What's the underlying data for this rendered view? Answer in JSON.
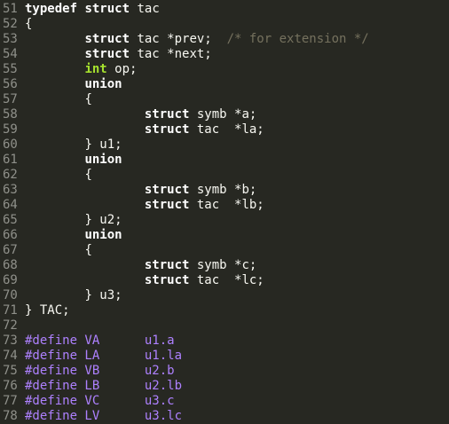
{
  "editor": {
    "lines": [
      {
        "num": "51",
        "segments": [
          {
            "t": "kw",
            "v": "typedef"
          },
          {
            "t": "ws",
            "v": " "
          },
          {
            "t": "kw",
            "v": "struct"
          },
          {
            "t": "plain",
            "v": " tac"
          }
        ]
      },
      {
        "num": "52",
        "segments": [
          {
            "t": "plain",
            "v": "{"
          }
        ]
      },
      {
        "num": "53",
        "segments": [
          {
            "t": "ws",
            "v": "        "
          },
          {
            "t": "kw",
            "v": "struct"
          },
          {
            "t": "plain",
            "v": " tac *prev;  "
          },
          {
            "t": "cmt",
            "v": "/* for extension */"
          }
        ]
      },
      {
        "num": "54",
        "segments": [
          {
            "t": "ws",
            "v": "        "
          },
          {
            "t": "kw",
            "v": "struct"
          },
          {
            "t": "plain",
            "v": " tac *next;"
          }
        ]
      },
      {
        "num": "55",
        "segments": [
          {
            "t": "ws",
            "v": "        "
          },
          {
            "t": "type",
            "v": "int"
          },
          {
            "t": "plain",
            "v": " op;"
          }
        ]
      },
      {
        "num": "56",
        "segments": [
          {
            "t": "ws",
            "v": "        "
          },
          {
            "t": "kw",
            "v": "union"
          }
        ]
      },
      {
        "num": "57",
        "segments": [
          {
            "t": "ws",
            "v": "        "
          },
          {
            "t": "plain",
            "v": "{"
          }
        ]
      },
      {
        "num": "58",
        "segments": [
          {
            "t": "ws",
            "v": "                "
          },
          {
            "t": "kw",
            "v": "struct"
          },
          {
            "t": "plain",
            "v": " symb *a;"
          }
        ]
      },
      {
        "num": "59",
        "segments": [
          {
            "t": "ws",
            "v": "                "
          },
          {
            "t": "kw",
            "v": "struct"
          },
          {
            "t": "plain",
            "v": " tac  *la;"
          }
        ]
      },
      {
        "num": "60",
        "segments": [
          {
            "t": "ws",
            "v": "        "
          },
          {
            "t": "plain",
            "v": "} u1;"
          }
        ]
      },
      {
        "num": "61",
        "segments": [
          {
            "t": "ws",
            "v": "        "
          },
          {
            "t": "kw",
            "v": "union"
          }
        ]
      },
      {
        "num": "62",
        "segments": [
          {
            "t": "ws",
            "v": "        "
          },
          {
            "t": "plain",
            "v": "{"
          }
        ]
      },
      {
        "num": "63",
        "segments": [
          {
            "t": "ws",
            "v": "                "
          },
          {
            "t": "kw",
            "v": "struct"
          },
          {
            "t": "plain",
            "v": " symb *b;"
          }
        ]
      },
      {
        "num": "64",
        "segments": [
          {
            "t": "ws",
            "v": "                "
          },
          {
            "t": "kw",
            "v": "struct"
          },
          {
            "t": "plain",
            "v": " tac  *lb;"
          }
        ]
      },
      {
        "num": "65",
        "segments": [
          {
            "t": "ws",
            "v": "        "
          },
          {
            "t": "plain",
            "v": "} u2;"
          }
        ]
      },
      {
        "num": "66",
        "segments": [
          {
            "t": "ws",
            "v": "        "
          },
          {
            "t": "kw",
            "v": "union"
          }
        ]
      },
      {
        "num": "67",
        "segments": [
          {
            "t": "ws",
            "v": "        "
          },
          {
            "t": "plain",
            "v": "{"
          }
        ]
      },
      {
        "num": "68",
        "segments": [
          {
            "t": "ws",
            "v": "                "
          },
          {
            "t": "kw",
            "v": "struct"
          },
          {
            "t": "plain",
            "v": " symb *c;"
          }
        ]
      },
      {
        "num": "69",
        "segments": [
          {
            "t": "ws",
            "v": "                "
          },
          {
            "t": "kw",
            "v": "struct"
          },
          {
            "t": "plain",
            "v": " tac  *lc;"
          }
        ]
      },
      {
        "num": "70",
        "segments": [
          {
            "t": "ws",
            "v": "        "
          },
          {
            "t": "plain",
            "v": "} u3;"
          }
        ]
      },
      {
        "num": "71",
        "segments": [
          {
            "t": "plain",
            "v": "} TAC;"
          }
        ]
      },
      {
        "num": "72",
        "segments": []
      },
      {
        "num": "73",
        "segments": [
          {
            "t": "pp",
            "v": "#define VA      u1.a"
          }
        ]
      },
      {
        "num": "74",
        "segments": [
          {
            "t": "pp",
            "v": "#define LA      u1.la"
          }
        ]
      },
      {
        "num": "75",
        "segments": [
          {
            "t": "pp",
            "v": "#define VB      u2.b"
          }
        ]
      },
      {
        "num": "76",
        "segments": [
          {
            "t": "pp",
            "v": "#define LB      u2.lb"
          }
        ]
      },
      {
        "num": "77",
        "segments": [
          {
            "t": "pp",
            "v": "#define VC      u3.c"
          }
        ]
      },
      {
        "num": "78",
        "segments": [
          {
            "t": "pp",
            "v": "#define LV      u3.lc"
          }
        ]
      }
    ]
  },
  "colors": {
    "background": "#272822",
    "gutter": "#8f908a",
    "text": "#f8f8f2",
    "keyword": "#ffffff",
    "type": "#a6e22e",
    "comment": "#75715e",
    "preprocessor": "#ae81ff"
  }
}
